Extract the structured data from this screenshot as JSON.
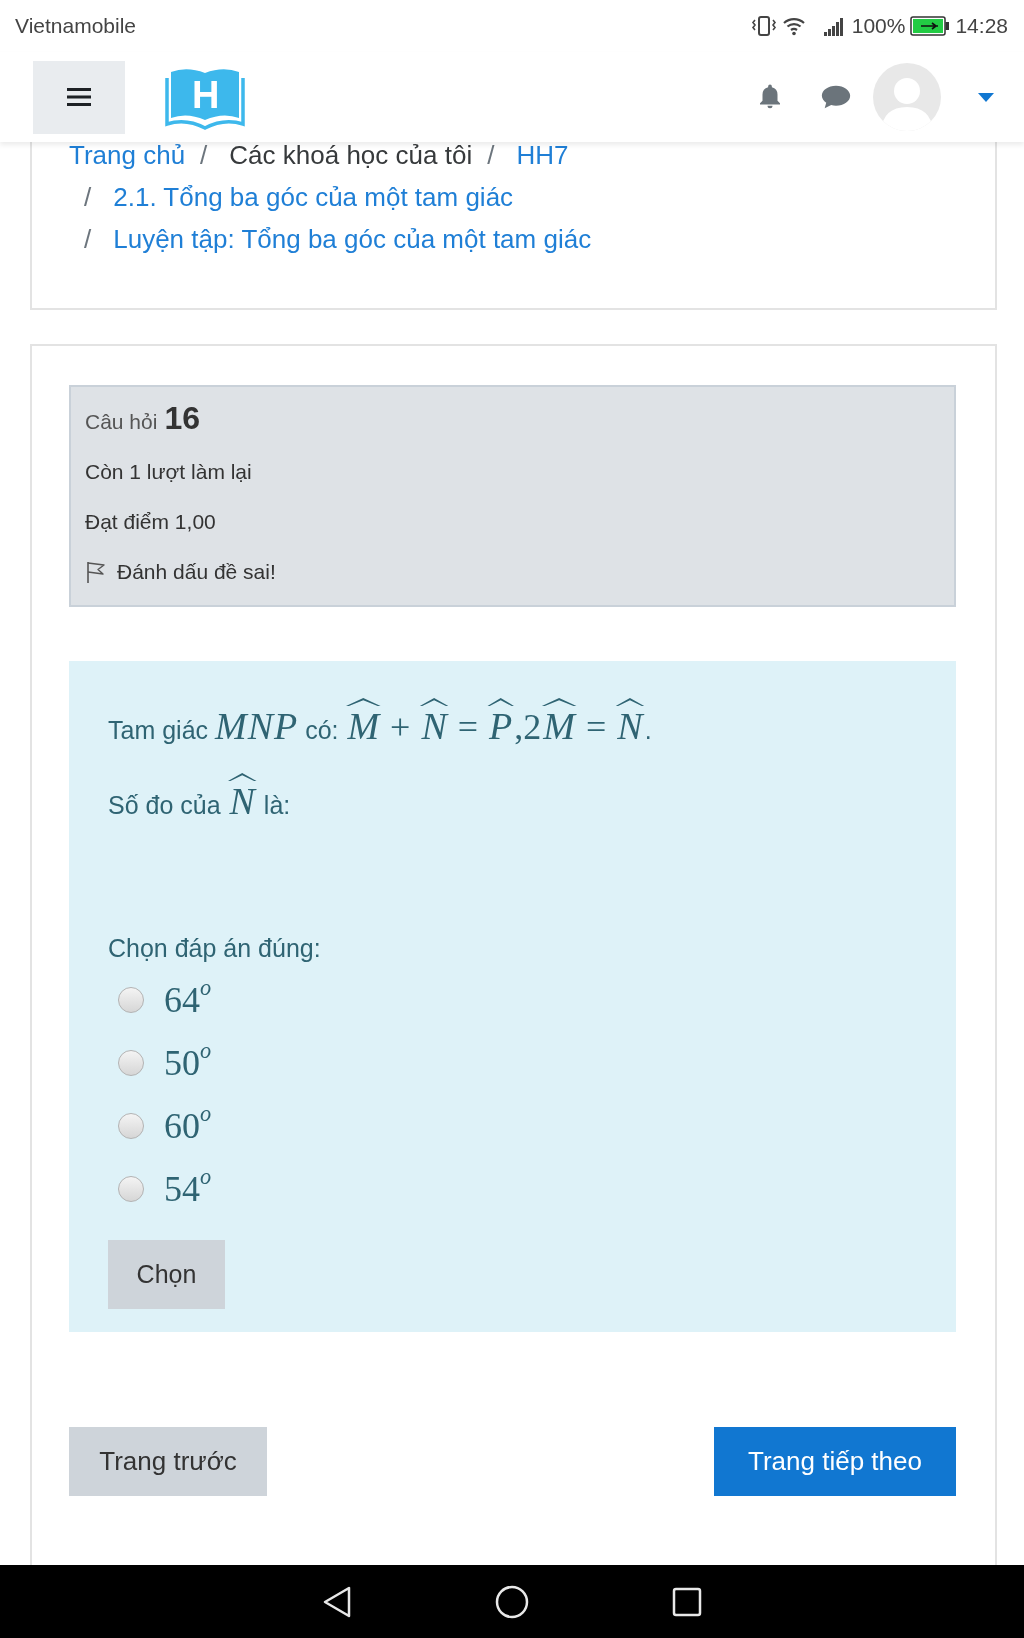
{
  "status_bar": {
    "carrier": "Vietnamobile",
    "battery": "100%",
    "time": "14:28"
  },
  "header": {
    "logo_letter": "H"
  },
  "breadcrumb": [
    {
      "kind": "link",
      "text": "Trang chủ"
    },
    {
      "kind": "text",
      "separator": "/",
      "text": "Các khoá học của tôi"
    },
    {
      "kind": "link",
      "separator": "/",
      "text": "HH7"
    },
    {
      "kind": "link",
      "separator": "/",
      "text": "2.1. Tổng ba góc của một tam giác"
    },
    {
      "kind": "link",
      "separator": "/",
      "text": "Luyện tập: Tổng ba góc của một tam giác"
    }
  ],
  "question_info": {
    "label": "Câu hỏi",
    "number": "16",
    "state": "Còn 1 lượt làm lại",
    "grade": "Đạt điểm 1,00",
    "flag_label": "Đánh dấu đề sai!",
    "flagged": false
  },
  "question": {
    "lines": [
      [
        {
          "kind": "text",
          "text": "Tam giác "
        },
        {
          "kind": "var",
          "text": "MNP"
        },
        {
          "kind": "text",
          "text": " có: "
        },
        {
          "kind": "angle",
          "text": "M"
        },
        {
          "kind": "op",
          "text": " + "
        },
        {
          "kind": "angle",
          "text": "N"
        },
        {
          "kind": "op",
          "text": " = "
        },
        {
          "kind": "angle",
          "text": "P"
        },
        {
          "kind": "num",
          "text": ",2"
        },
        {
          "kind": "angle",
          "text": "M"
        },
        {
          "kind": "op",
          "text": " = "
        },
        {
          "kind": "angle",
          "text": "N"
        },
        {
          "kind": "text",
          "text": "."
        }
      ],
      [
        {
          "kind": "text",
          "text": "Số đo của "
        },
        {
          "kind": "angle",
          "text": "N"
        },
        {
          "kind": "text",
          "text": " là:"
        }
      ]
    ],
    "prompt": "Chọn đáp án đúng:",
    "options": [
      {
        "label": "64$^{o}$",
        "selected": false
      },
      {
        "label": "50$^{o}$",
        "selected": false
      },
      {
        "label": "60$^{o}$",
        "selected": false
      },
      {
        "label": "54$^{o}$",
        "selected": false
      }
    ],
    "check_button": "Chọn"
  },
  "navigation": {
    "previous": "Trang trước",
    "next": "Trang tiếp theo"
  }
}
